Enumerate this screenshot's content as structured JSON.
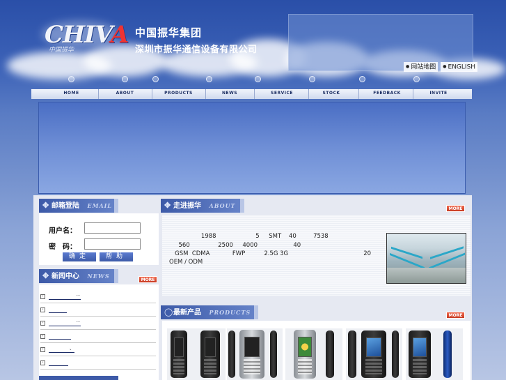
{
  "header": {
    "logo_text": "CHIVA",
    "logo_subtext": "中国振华",
    "company_line1": "中国振华集团",
    "company_line2": "深圳市振华通信设备有限公司",
    "top_links": [
      "网站地图",
      "ENGLISH"
    ]
  },
  "nav": {
    "items": [
      "HOME",
      "ABOUT",
      "PRODUCTS",
      "NEWS",
      "SERVICE",
      "STOCK",
      "FEEDBACK",
      "INVITE"
    ]
  },
  "email_section": {
    "title_cn": "邮箱登陆",
    "title_en": "EMAIL",
    "username_label": "用户名：",
    "password_label": "密　码：",
    "username_value": "",
    "password_value": "",
    "confirm_button": "确定",
    "help_button": "帮助"
  },
  "news_section": {
    "title_cn": "新闻中心",
    "title_en": "NEWS",
    "more_label": "MORE",
    "items": [
      "...",
      "",
      "...",
      "",
      "、",
      ""
    ]
  },
  "about_section": {
    "title_cn": "走进振华",
    "title_en": "ABOUT",
    "more_label": "MORE",
    "lines": [
      "                 1988                     5     SMT    40         7538",
      "     560               2500     4000                   40",
      "   GSM  CDMA            FWP          2.5G 3G                                        20",
      "OEM / ODM"
    ]
  },
  "products_section": {
    "title_cn": "最新产品",
    "title_en": "PRODUCTS",
    "more_label": "MORE"
  },
  "colors": {
    "nav_text": "#1d2f63",
    "section_header": "#3d5aa8",
    "more_button": "#d9492f"
  }
}
